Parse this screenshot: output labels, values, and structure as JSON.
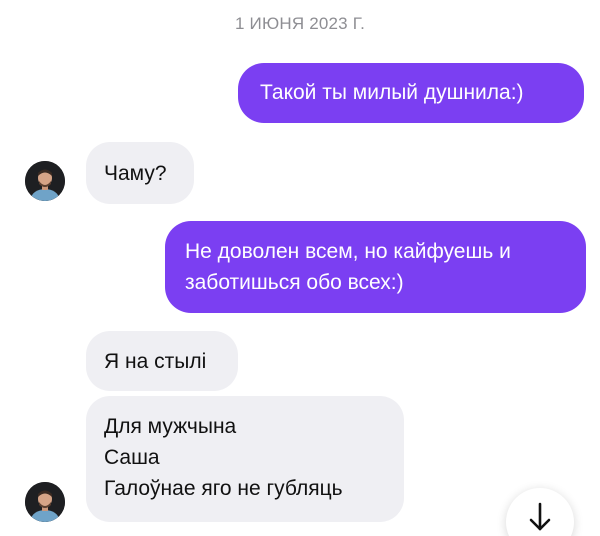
{
  "chat": {
    "date_label": "1 ИЮНЯ 2023 Г.",
    "messages": [
      {
        "direction": "outgoing",
        "lines": [
          "Такой ты милый душнила:)"
        ]
      },
      {
        "direction": "incoming",
        "lines": [
          "Чаму?"
        ]
      },
      {
        "direction": "outgoing",
        "lines": [
          "Не доволен всем, но кайфуешь и",
          "заботишься обо всех:)"
        ]
      },
      {
        "direction": "incoming",
        "lines": [
          "Я на стылі"
        ]
      },
      {
        "direction": "incoming",
        "lines": [
          "Для мужчына",
          "Саша",
          "Галоўнае яго не губляць"
        ]
      }
    ]
  },
  "icons": {
    "avatar": "user-avatar-photo",
    "scroll_down": "arrow-down-icon"
  },
  "colors": {
    "outgoing_bubble": "#7b3ff2",
    "incoming_bubble": "#efeff3",
    "date_text": "#8e8e93",
    "background": "#ffffff"
  }
}
